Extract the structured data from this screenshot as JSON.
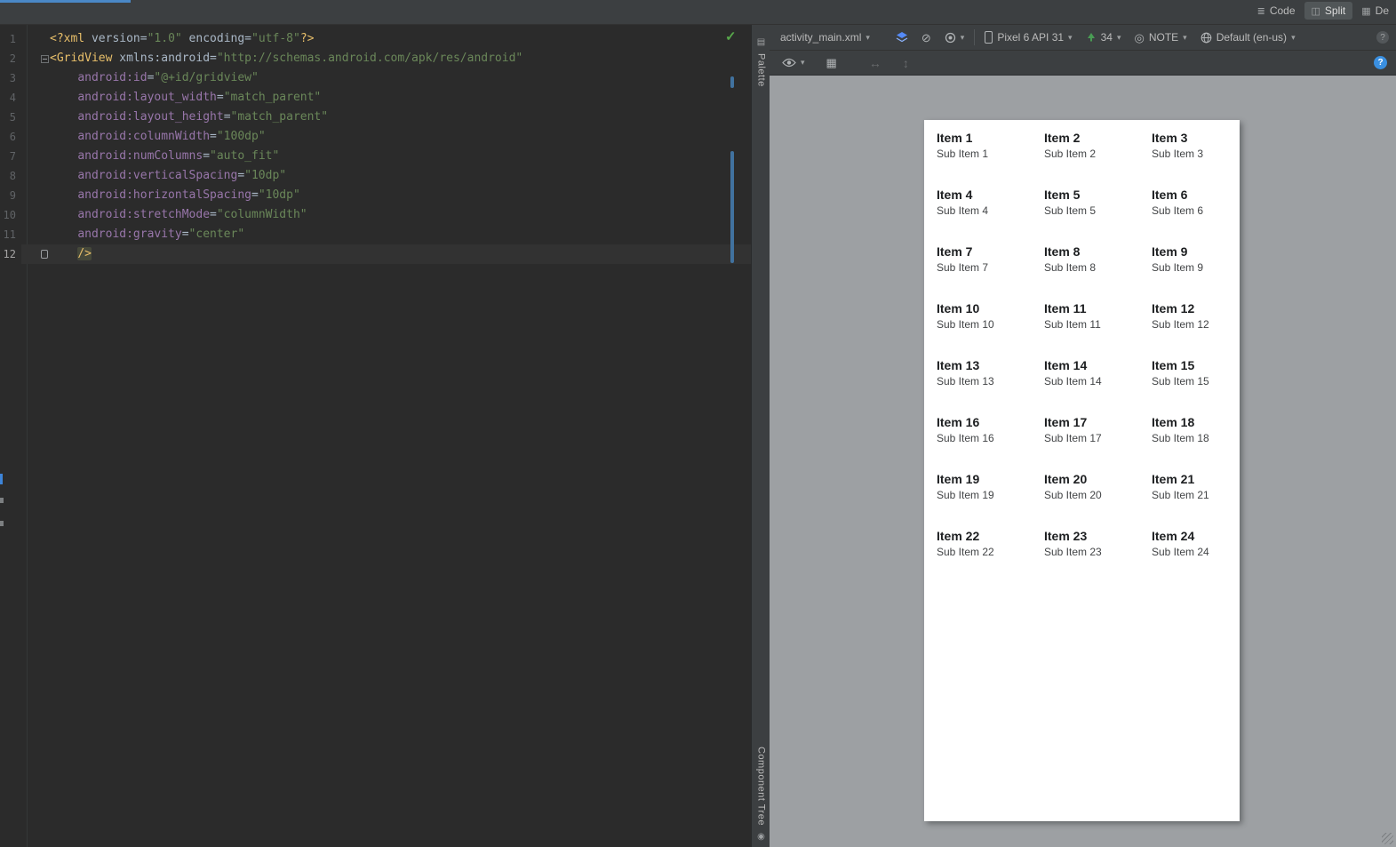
{
  "colors": {
    "accent_blue": "#4a88c7",
    "change_bar_blue": "#41729f",
    "check_green": "#57a64a",
    "tag_yellow": "#e8bf6a",
    "attr_purple": "#9876aa",
    "string_green": "#6a8759",
    "design_surface_gray": "#9da0a3",
    "help_blue": "#3a8fe0"
  },
  "icons": {
    "chevron": "▾",
    "code_view": "≣",
    "split_view": "◫",
    "design_view": "▦",
    "slash_circle": "⊘",
    "theme_circle": "◎",
    "grid_overlay": "▦",
    "h_arrow": "↔",
    "v_arrow": "↕",
    "palette": "▤",
    "component_tree": "◉",
    "help": "?",
    "issue": "?",
    "check": "✓"
  },
  "topbar": {
    "toggles": [
      {
        "label": "Code"
      },
      {
        "label": "Split"
      },
      {
        "label": "De"
      }
    ]
  },
  "editor": {
    "lines": [
      {
        "n": "1",
        "tokens": [
          {
            "t": "<?xml ",
            "c": "tag"
          },
          {
            "t": "version=",
            "c": "pln"
          },
          {
            "t": "\"1.0\"",
            "c": "str"
          },
          {
            "t": " encoding=",
            "c": "pln"
          },
          {
            "t": "\"utf-8\"",
            "c": "str"
          },
          {
            "t": "?>",
            "c": "tag"
          }
        ]
      },
      {
        "n": "2",
        "fold": true,
        "tokens": [
          {
            "t": "<GridView ",
            "c": "tag"
          },
          {
            "t": "xmlns:android=",
            "c": "pln"
          },
          {
            "t": "\"http://schemas.android.com/apk/res/android\"",
            "c": "str"
          }
        ]
      },
      {
        "n": "3",
        "tokens": [
          {
            "t": "    ",
            "c": "pln"
          },
          {
            "t": "android:id",
            "c": "attr"
          },
          {
            "t": "=",
            "c": "pln"
          },
          {
            "t": "\"@+id/gridview\"",
            "c": "str"
          }
        ]
      },
      {
        "n": "4",
        "tokens": [
          {
            "t": "    ",
            "c": "pln"
          },
          {
            "t": "android:layout_width",
            "c": "attr"
          },
          {
            "t": "=",
            "c": "pln"
          },
          {
            "t": "\"match_parent\"",
            "c": "str"
          }
        ]
      },
      {
        "n": "5",
        "tokens": [
          {
            "t": "    ",
            "c": "pln"
          },
          {
            "t": "android:layout_height",
            "c": "attr"
          },
          {
            "t": "=",
            "c": "pln"
          },
          {
            "t": "\"match_parent\"",
            "c": "str"
          }
        ]
      },
      {
        "n": "6",
        "tokens": [
          {
            "t": "    ",
            "c": "pln"
          },
          {
            "t": "android:columnWidth",
            "c": "attr"
          },
          {
            "t": "=",
            "c": "pln"
          },
          {
            "t": "\"100dp\"",
            "c": "str"
          }
        ]
      },
      {
        "n": "7",
        "tokens": [
          {
            "t": "    ",
            "c": "pln"
          },
          {
            "t": "android:numColumns",
            "c": "attr"
          },
          {
            "t": "=",
            "c": "pln"
          },
          {
            "t": "\"auto_fit\"",
            "c": "str"
          }
        ]
      },
      {
        "n": "8",
        "tokens": [
          {
            "t": "    ",
            "c": "pln"
          },
          {
            "t": "android:verticalSpacing",
            "c": "attr"
          },
          {
            "t": "=",
            "c": "pln"
          },
          {
            "t": "\"10dp\"",
            "c": "str"
          }
        ]
      },
      {
        "n": "9",
        "tokens": [
          {
            "t": "    ",
            "c": "pln"
          },
          {
            "t": "android:horizontalSpacing",
            "c": "attr"
          },
          {
            "t": "=",
            "c": "pln"
          },
          {
            "t": "\"10dp\"",
            "c": "str"
          }
        ]
      },
      {
        "n": "10",
        "tokens": [
          {
            "t": "    ",
            "c": "pln"
          },
          {
            "t": "android:stretchMode",
            "c": "attr"
          },
          {
            "t": "=",
            "c": "pln"
          },
          {
            "t": "\"columnWidth\"",
            "c": "str"
          }
        ]
      },
      {
        "n": "11",
        "tokens": [
          {
            "t": "    ",
            "c": "pln"
          },
          {
            "t": "android:gravity",
            "c": "attr"
          },
          {
            "t": "=",
            "c": "pln"
          },
          {
            "t": "\"center\"",
            "c": "str"
          }
        ]
      },
      {
        "n": "12",
        "current": true,
        "mark": true,
        "tokens": [
          {
            "t": "    ",
            "c": "pln"
          },
          {
            "t": "/>",
            "c": "tag",
            "hl": true
          }
        ]
      }
    ]
  },
  "tool_strip": {
    "palette": "Palette",
    "component_tree": "Component Tree"
  },
  "design_toolbar": {
    "file": "activity_main.xml",
    "device": "Pixel 6 API 31",
    "api_level": "34",
    "theme": "NOTE",
    "locale": "Default (en-us)"
  },
  "preview": {
    "items": [
      {
        "title": "Item 1",
        "sub": "Sub Item 1"
      },
      {
        "title": "Item 2",
        "sub": "Sub Item 2"
      },
      {
        "title": "Item 3",
        "sub": "Sub Item 3"
      },
      {
        "title": "Item 4",
        "sub": "Sub Item 4"
      },
      {
        "title": "Item 5",
        "sub": "Sub Item 5"
      },
      {
        "title": "Item 6",
        "sub": "Sub Item 6"
      },
      {
        "title": "Item 7",
        "sub": "Sub Item 7"
      },
      {
        "title": "Item 8",
        "sub": "Sub Item 8"
      },
      {
        "title": "Item 9",
        "sub": "Sub Item 9"
      },
      {
        "title": "Item 10",
        "sub": "Sub Item 10"
      },
      {
        "title": "Item 11",
        "sub": "Sub Item 11"
      },
      {
        "title": "Item 12",
        "sub": "Sub Item 12"
      },
      {
        "title": "Item 13",
        "sub": "Sub Item 13"
      },
      {
        "title": "Item 14",
        "sub": "Sub Item 14"
      },
      {
        "title": "Item 15",
        "sub": "Sub Item 15"
      },
      {
        "title": "Item 16",
        "sub": "Sub Item 16"
      },
      {
        "title": "Item 17",
        "sub": "Sub Item 17"
      },
      {
        "title": "Item 18",
        "sub": "Sub Item 18"
      },
      {
        "title": "Item 19",
        "sub": "Sub Item 19"
      },
      {
        "title": "Item 20",
        "sub": "Sub Item 20"
      },
      {
        "title": "Item 21",
        "sub": "Sub Item 21"
      },
      {
        "title": "Item 22",
        "sub": "Sub Item 22"
      },
      {
        "title": "Item 23",
        "sub": "Sub Item 23"
      },
      {
        "title": "Item 24",
        "sub": "Sub Item 24"
      }
    ]
  }
}
